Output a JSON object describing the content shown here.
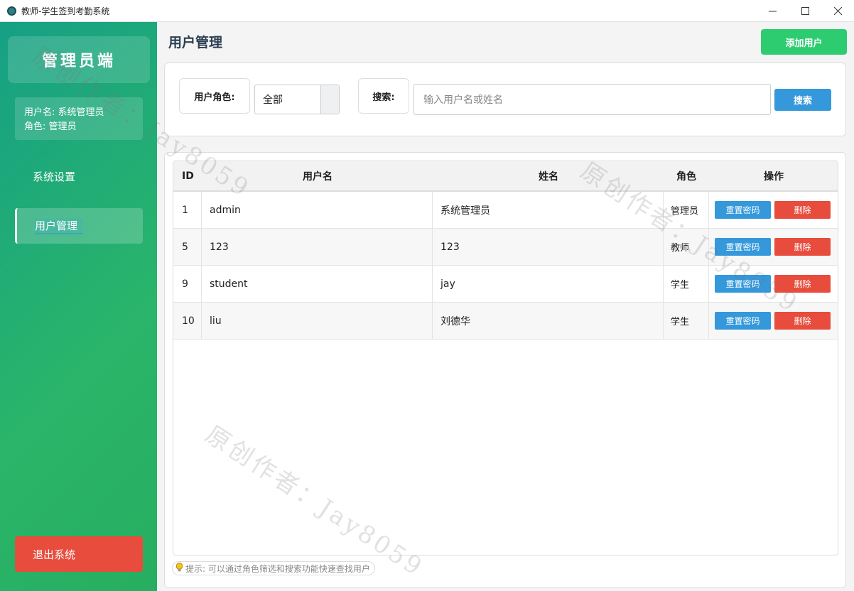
{
  "window": {
    "title": "教师-学生签到考勤系统"
  },
  "sidebar": {
    "brand": "管理员端",
    "user_line": "用户名: 系统管理员",
    "role_line": "角色: 管理员",
    "nav": [
      "系统设置",
      "用户管理"
    ],
    "logout": "退出系统"
  },
  "header": {
    "title": "用户管理",
    "add_button": "添加用户"
  },
  "filter": {
    "role_label": "用户角色:",
    "role_value": "全部",
    "search_label": "搜索:",
    "search_placeholder": "输入用户名或姓名",
    "search_button": "搜索"
  },
  "table": {
    "headers": [
      "ID",
      "用户名",
      "姓名",
      "角色",
      "操作"
    ],
    "rows": [
      {
        "id": "1",
        "username": "admin",
        "name": "系统管理员",
        "role": "管理员"
      },
      {
        "id": "5",
        "username": "123",
        "name": "123",
        "role": "教师"
      },
      {
        "id": "9",
        "username": "student",
        "name": "jay",
        "role": "学生"
      },
      {
        "id": "10",
        "username": "liu",
        "name": "刘德华",
        "role": "学生"
      }
    ],
    "reset_label": "重置密码",
    "delete_label": "删除"
  },
  "hint": "提示: 可以通过角色筛选和搜索功能快速查找用户",
  "watermark": "原创作者：Jay8059",
  "colors": {
    "accent_green": "#2ecc71",
    "primary_blue": "#3498db",
    "danger_red": "#e74c3c",
    "sidebar_start": "#16a085",
    "sidebar_end": "#27ae60"
  }
}
